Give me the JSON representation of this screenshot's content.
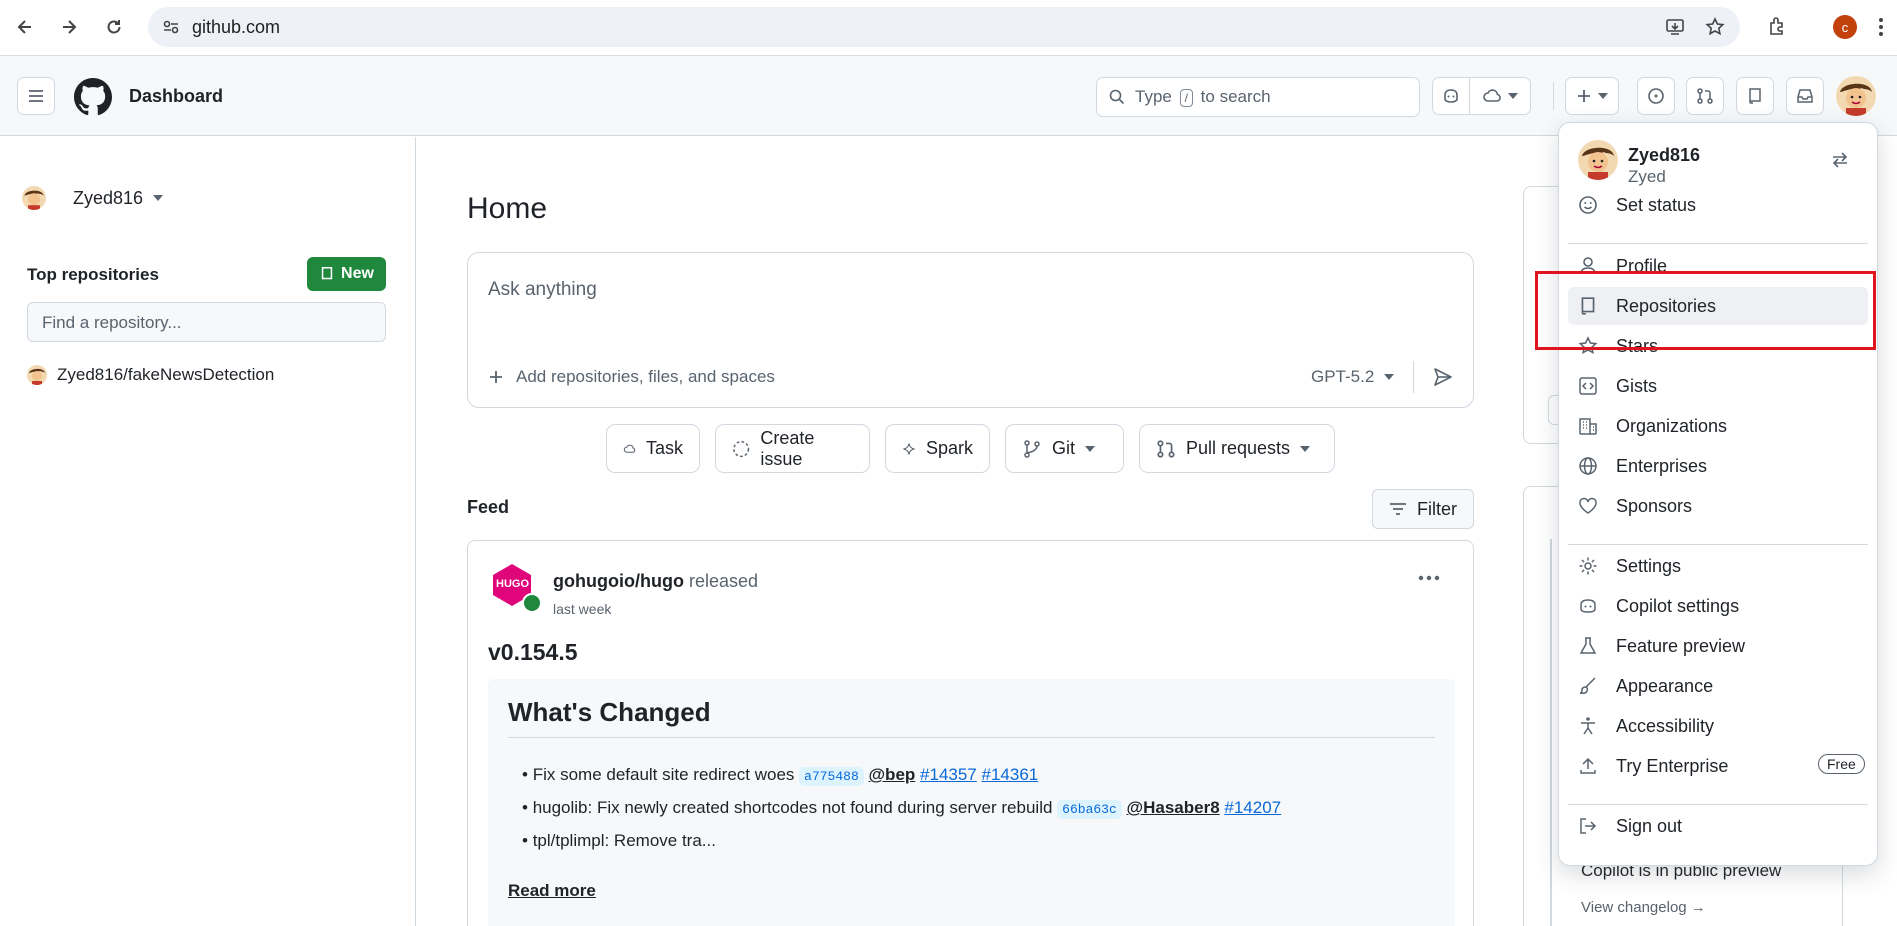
{
  "browser": {
    "url": "github.com",
    "profile_initial": "c"
  },
  "header": {
    "title": "Dashboard",
    "search_prefix": "Type",
    "search_key": "/",
    "search_suffix": "to search"
  },
  "sidebar": {
    "username": "Zyed816",
    "top_repos_title": "Top repositories",
    "new_button": "New",
    "find_placeholder": "Find a repository...",
    "repos": [
      "Zyed816/fakeNewsDetection"
    ]
  },
  "main": {
    "heading": "Home",
    "composer_placeholder": "Ask anything",
    "add_context": "Add repositories, files, and spaces",
    "model": "GPT-5.2",
    "actions": [
      "Task",
      "Create issue",
      "Spark",
      "Git",
      "Pull requests"
    ],
    "feed_title": "Feed",
    "filter_label": "Filter"
  },
  "feed_item": {
    "repo": "gohugoio/hugo",
    "action": "released",
    "time": "last week",
    "version": "v0.154.5",
    "heading": "What's Changed",
    "bullets": [
      {
        "text": "Fix some default site redirect woes",
        "sha": "a775488",
        "mention": "@bep",
        "links": [
          "#14357",
          "#14361"
        ]
      },
      {
        "text": "hugolib: Fix newly created shortcodes not found during server rebuild",
        "sha": "66ba63c",
        "mention": "@Hasaber8",
        "links": [
          "#14207"
        ]
      },
      {
        "text": "tpl/tplimpl: Remove tra..."
      }
    ],
    "read_more": "Read more",
    "hugo_logo_text": "HUGO"
  },
  "right_panel": {
    "copilot_text": "Copilot is in public preview",
    "changelog_link": "View changelog →"
  },
  "menu": {
    "username": "Zyed816",
    "fullname": "Zyed",
    "set_status": "Set status",
    "group1": [
      "Profile",
      "Repositories",
      "Stars",
      "Gists",
      "Organizations",
      "Enterprises",
      "Sponsors"
    ],
    "group2": [
      "Settings",
      "Copilot settings",
      "Feature preview",
      "Appearance",
      "Accessibility",
      "Try Enterprise"
    ],
    "free_badge": "Free",
    "sign_out": "Sign out"
  },
  "colors": {
    "accent": "#0969da",
    "new_button": "#1f883d",
    "highlight": "#e0141e"
  }
}
